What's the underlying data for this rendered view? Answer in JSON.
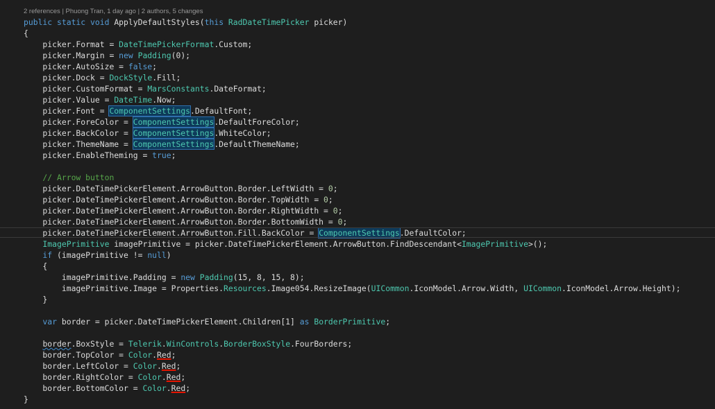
{
  "codelens": "2 references | Phuong Tran, 1 day ago | 2 authors, 5 changes",
  "lines": [
    [
      [
        "kw",
        "public static void "
      ],
      [
        "tx",
        "ApplyDefaultStyles("
      ],
      [
        "kw",
        "this "
      ],
      [
        "ty",
        "RadDateTimePicker"
      ],
      [
        "tx",
        " picker)"
      ]
    ],
    [
      [
        "tx",
        "{"
      ]
    ],
    [
      [
        "tx",
        "    picker.Format = "
      ],
      [
        "ty",
        "DateTimePickerFormat"
      ],
      [
        "tx",
        ".Custom;"
      ]
    ],
    [
      [
        "tx",
        "    picker.Margin = "
      ],
      [
        "kw",
        "new "
      ],
      [
        "ty",
        "Padding"
      ],
      [
        "tx",
        "(0);"
      ]
    ],
    [
      [
        "tx",
        "    picker.AutoSize = "
      ],
      [
        "kw",
        "false"
      ],
      [
        "tx",
        ";"
      ]
    ],
    [
      [
        "tx",
        "    picker.Dock = "
      ],
      [
        "ty",
        "DockStyle"
      ],
      [
        "tx",
        ".Fill;"
      ]
    ],
    [
      [
        "tx",
        "    picker.CustomFormat = "
      ],
      [
        "ty",
        "MarsConstants"
      ],
      [
        "tx",
        ".DateFormat;"
      ]
    ],
    [
      [
        "tx",
        "    picker.Value = "
      ],
      [
        "ty",
        "DateTime"
      ],
      [
        "tx",
        ".Now;"
      ]
    ],
    [
      [
        "tx",
        "    picker.Font = "
      ],
      [
        "ty hl",
        "ComponentSettings"
      ],
      [
        "tx",
        ".DefaultFont;"
      ]
    ],
    [
      [
        "tx",
        "    picker.ForeColor = "
      ],
      [
        "ty hl",
        "ComponentSettings"
      ],
      [
        "tx",
        ".DefaultForeColor;"
      ]
    ],
    [
      [
        "tx",
        "    picker.BackColor = "
      ],
      [
        "ty hl",
        "ComponentSettings"
      ],
      [
        "tx",
        ".WhiteColor;"
      ]
    ],
    [
      [
        "tx",
        "    picker.ThemeName = "
      ],
      [
        "ty hl",
        "ComponentSettings"
      ],
      [
        "tx",
        ".DefaultThemeName;"
      ]
    ],
    [
      [
        "tx",
        "    picker.EnableTheming = "
      ],
      [
        "kw",
        "true"
      ],
      [
        "tx",
        ";"
      ]
    ],
    [],
    [
      [
        "cm",
        "    // Arrow button"
      ]
    ],
    [
      [
        "tx",
        "    picker.DateTimePickerElement.ArrowButton.Border.LeftWidth = "
      ],
      [
        "nm",
        "0"
      ],
      [
        "tx",
        ";"
      ]
    ],
    [
      [
        "tx",
        "    picker.DateTimePickerElement.ArrowButton.Border.TopWidth = "
      ],
      [
        "nm",
        "0"
      ],
      [
        "tx",
        ";"
      ]
    ],
    [
      [
        "tx",
        "    picker.DateTimePickerElement.ArrowButton.Border.RightWidth = "
      ],
      [
        "nm",
        "0"
      ],
      [
        "tx",
        ";"
      ]
    ],
    [
      [
        "tx",
        "    picker.DateTimePickerElement.ArrowButton.Border.BottomWidth = "
      ],
      [
        "nm",
        "0"
      ],
      [
        "tx",
        ";"
      ]
    ],
    [
      [
        "tx",
        "    picker.DateTimePickerElement.ArrowButton.Fill.BackColor = "
      ],
      [
        "caret",
        ""
      ],
      [
        "ty hl",
        "ComponentSettings"
      ],
      [
        "tx",
        ".DefaultColor;"
      ]
    ],
    [
      [
        "ty",
        "    ImagePrimitive"
      ],
      [
        "tx",
        " imagePrimitive = picker.DateTimePickerElement.ArrowButton.FindDescendant<"
      ],
      [
        "ty",
        "ImagePrimitive"
      ],
      [
        "tx",
        ">();"
      ]
    ],
    [
      [
        "kw",
        "    if"
      ],
      [
        "tx",
        " (imagePrimitive != "
      ],
      [
        "kw",
        "null"
      ],
      [
        "tx",
        ")"
      ]
    ],
    [
      [
        "tx",
        "    {"
      ]
    ],
    [
      [
        "tx",
        "        imagePrimitive.Padding = "
      ],
      [
        "kw",
        "new "
      ],
      [
        "ty",
        "Padding"
      ],
      [
        "tx",
        "(15, 8, 15, 8);"
      ]
    ],
    [
      [
        "tx",
        "        imagePrimitive.Image = Properties."
      ],
      [
        "ty",
        "Resources"
      ],
      [
        "tx",
        ".Image054.ResizeImage("
      ],
      [
        "ty",
        "UICommon"
      ],
      [
        "tx",
        ".IconModel.Arrow.Width, "
      ],
      [
        "ty",
        "UICommon"
      ],
      [
        "tx",
        ".IconModel.Arrow.Height);"
      ]
    ],
    [
      [
        "tx",
        "    }"
      ]
    ],
    [],
    [
      [
        "kw",
        "    var"
      ],
      [
        "tx",
        " border = picker.DateTimePickerElement.Children[1] "
      ],
      [
        "kw",
        "as "
      ],
      [
        "ty",
        "BorderPrimitive"
      ],
      [
        "tx",
        ";"
      ]
    ],
    [],
    [
      [
        "tx",
        "    "
      ],
      [
        "tx squig",
        "border"
      ],
      [
        "tx",
        ".BoxStyle = "
      ],
      [
        "ty",
        "Telerik"
      ],
      [
        "tx",
        "."
      ],
      [
        "ty",
        "WinControls"
      ],
      [
        "tx",
        "."
      ],
      [
        "ty",
        "BorderBoxStyle"
      ],
      [
        "tx",
        ".FourBorders;"
      ]
    ],
    [
      [
        "tx",
        "    border.TopColor = "
      ],
      [
        "ty",
        "Color"
      ],
      [
        "tx",
        "."
      ],
      [
        "tx err",
        "Red"
      ],
      [
        "tx",
        ";"
      ]
    ],
    [
      [
        "tx",
        "    border.LeftColor = "
      ],
      [
        "ty",
        "Color"
      ],
      [
        "tx",
        "."
      ],
      [
        "tx err",
        "Red"
      ],
      [
        "tx",
        ";"
      ]
    ],
    [
      [
        "tx",
        "    border.RightColor = "
      ],
      [
        "ty",
        "Color"
      ],
      [
        "tx",
        "."
      ],
      [
        "tx err",
        "Red"
      ],
      [
        "tx",
        ";"
      ]
    ],
    [
      [
        "tx",
        "    border.BottomColor = "
      ],
      [
        "ty",
        "Color"
      ],
      [
        "tx",
        "."
      ],
      [
        "tx err",
        "Red"
      ],
      [
        "tx",
        ";"
      ]
    ],
    [
      [
        "tx",
        "}"
      ]
    ]
  ],
  "current_line": 19
}
